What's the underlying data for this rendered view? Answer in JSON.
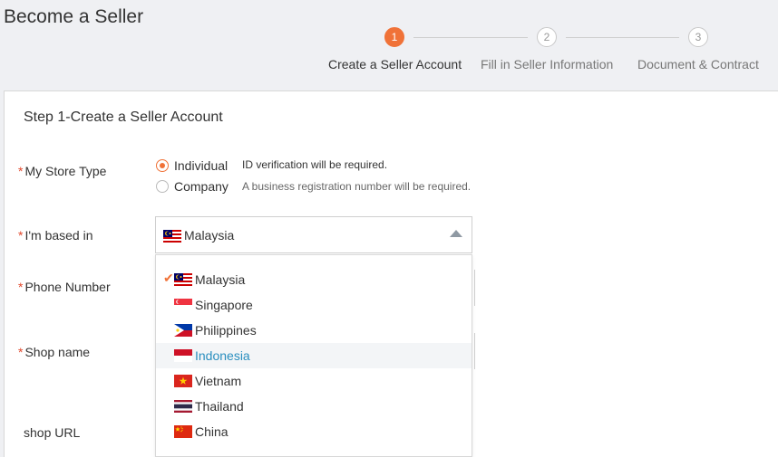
{
  "header": {
    "title": "Become a Seller",
    "steps": [
      {
        "number": "1",
        "label": "Create a Seller Account",
        "active": true
      },
      {
        "number": "2",
        "label": "Fill in Seller Information",
        "active": false
      },
      {
        "number": "3",
        "label": "Document & Contract",
        "active": false
      }
    ]
  },
  "form": {
    "section_title": "Step 1-Create a Seller Account",
    "required_mark": "*",
    "store_type": {
      "label": "My Store Type",
      "options": [
        {
          "label": "Individual",
          "description": "ID verification will be required.",
          "checked": true
        },
        {
          "label": "Company",
          "description": "A business registration number will be required.",
          "checked": false
        }
      ]
    },
    "based_in": {
      "label": "I'm based in",
      "selected": "Malaysia",
      "options": [
        {
          "label": "Malaysia",
          "flag": "malaysia-flag-icon",
          "selected": true
        },
        {
          "label": "Singapore",
          "flag": "singapore-flag-icon"
        },
        {
          "label": "Philippines",
          "flag": "philippines-flag-icon"
        },
        {
          "label": "Indonesia",
          "flag": "indonesia-flag-icon",
          "hover": true
        },
        {
          "label": "Vietnam",
          "flag": "vietnam-flag-icon"
        },
        {
          "label": "Thailand",
          "flag": "thailand-flag-icon"
        },
        {
          "label": "China",
          "flag": "china-flag-icon"
        }
      ]
    },
    "phone": {
      "label": "Phone Number"
    },
    "shop_name": {
      "label": "Shop name"
    },
    "shop_url": {
      "label": "shop URL"
    },
    "check_glyph": "✔"
  },
  "colors": {
    "accent": "#f07238",
    "link": "#2a8fbf",
    "required": "#e2472b"
  }
}
